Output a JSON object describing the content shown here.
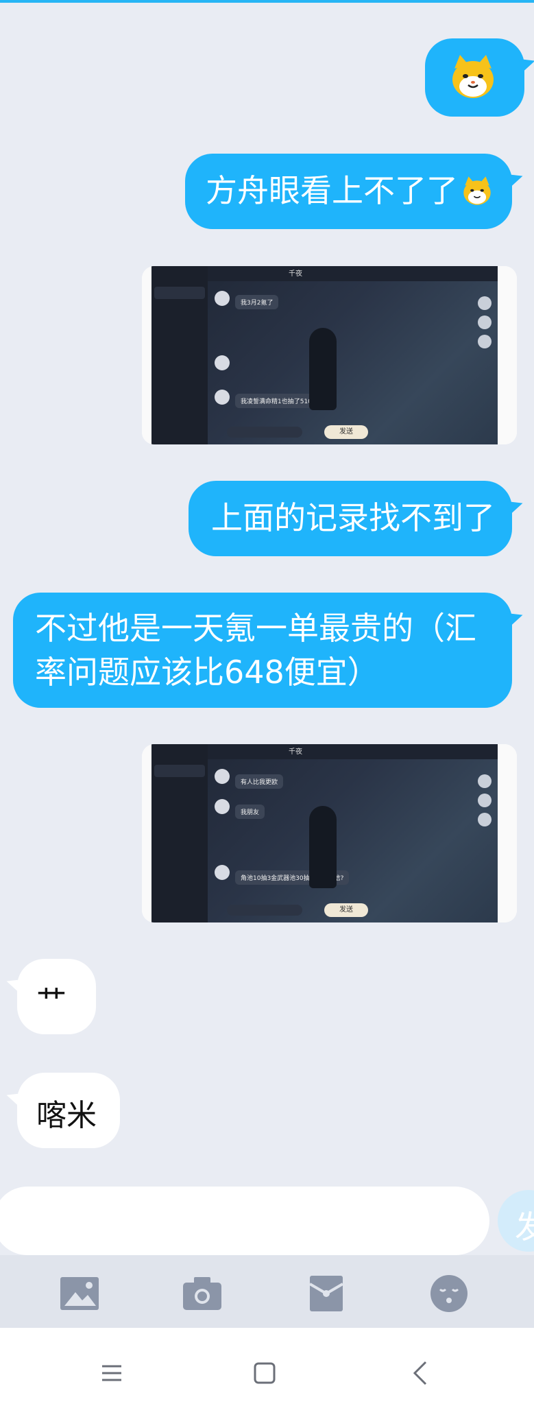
{
  "messages": {
    "m1_sticker": "yellow-cat-sticker",
    "m2_text": "方舟眼看上不了了",
    "m4_text": "上面的记录找不到了",
    "m5_text": "不过他是一天氪一单最贵的（汇率问题应该比648便宜）",
    "m7_text": "艹",
    "m8_text": "喀米"
  },
  "screenshot1": {
    "title": "千夜",
    "msg1": "我3月2氪了",
    "msg2": "我凌誓满命精1也抽了510抽",
    "send_label": "发送"
  },
  "screenshot2": {
    "title": "千夜",
    "msg1": "有人比我更欧",
    "msg2": "我朋友",
    "msg3": "角池10抽3金武器池30抽饕金你敢信?",
    "send_label": "发送"
  },
  "input": {
    "send_label": "发"
  },
  "colors": {
    "outgoing_bubble": "#1fb4fb",
    "incoming_bubble": "#ffffff",
    "background": "#e9ecf3"
  },
  "toolbar": {
    "icons": [
      "image-icon",
      "camera-icon",
      "red-packet-icon",
      "emoji-icon"
    ]
  },
  "navbar": {
    "icons": [
      "menu-icon",
      "home-icon",
      "back-icon"
    ]
  }
}
